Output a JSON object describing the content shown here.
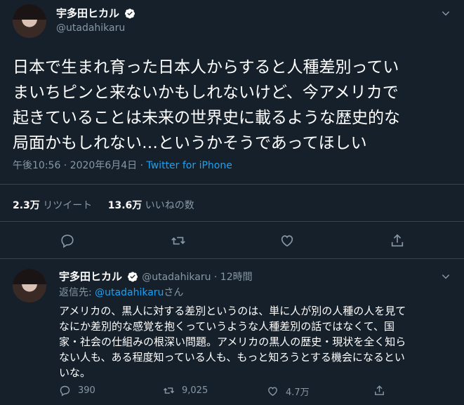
{
  "main_tweet": {
    "display_name": "宇多田ヒカル",
    "handle": "@utadahikaru",
    "text_lines": [
      "日本で生まれ育った日本人からすると人種差別ってい",
      "まいちピンと来ないかもしれないけど、今アメリカで",
      "起きていることは未来の世界史に載るような歴史的な",
      "局面かもしれない…というかそうであってほしい"
    ],
    "time": "午後10:56 · 2020年6月4日 · ",
    "source": "Twitter for iPhone",
    "retweets_count": "2.3万",
    "retweets_label": "リツイート",
    "likes_count": "13.6万",
    "likes_label": "いいねの数"
  },
  "reply_tweet": {
    "display_name": "宇多田ヒカル",
    "handle_time": "@utadahikaru · 12時間",
    "reply_prefix": "返信先: ",
    "reply_to": "@utadahikaru",
    "reply_suffix": "さん",
    "text_lines": [
      "アメリカの、黒人に対する差別というのは、単に人が別の人種の人を見て",
      "なにか差別的な感覚を抱くっていうような人種差別の話ではなくて、国",
      "家・社会の仕組みの根深い問題。アメリカの黒人の歴史・現状を全く知ら",
      "ない人も、ある程度知っている人も、もっと知ろうとする機会になるとい",
      "いな。"
    ],
    "reply_count": "390",
    "retweet_count": "9,025",
    "like_count": "4.7万"
  },
  "colors": {
    "background": "#15202b",
    "muted": "#8899a6",
    "accent": "#1da1f2",
    "divider": "#38444d"
  },
  "icons": [
    "verified-badge-icon",
    "chevron-down-icon",
    "reply-icon",
    "retweet-icon",
    "like-icon",
    "share-icon"
  ]
}
